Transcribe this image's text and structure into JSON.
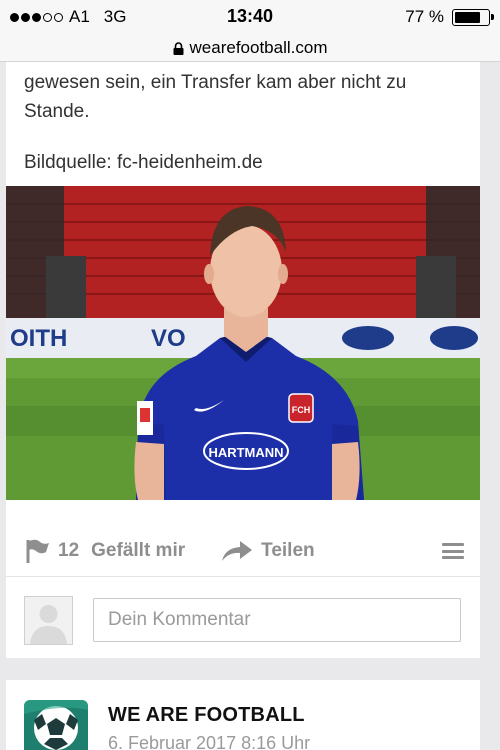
{
  "status_bar": {
    "carrier": "A1",
    "network": "3G",
    "time": "13:40",
    "battery_text": "77 %",
    "battery_level": 0.77,
    "signal_bars_filled": 3,
    "signal_bars_total": 5
  },
  "browser": {
    "url": "wearefootball.com",
    "lock_icon": "lock-icon"
  },
  "article": {
    "text": "gewesen sein, ein Transfer kam aber nicht zu Stande.",
    "image_source": "Bildquelle: fc-heidenheim.de",
    "photo": {
      "ad_board_left": "OITH",
      "ad_board_mid": "VO",
      "sponsor": "HARTMANN",
      "crest": "FCH"
    }
  },
  "actions": {
    "like_count": "12",
    "like_label": "Gefällt mir",
    "share_label": "Teilen",
    "like_icon": "flag-icon",
    "share_icon": "share-arrow-icon",
    "menu_icon": "menu-icon"
  },
  "comment": {
    "placeholder": "Dein Kommentar",
    "value": ""
  },
  "next_post": {
    "author": "WE ARE FOOTBALL",
    "date": "6. Februar 2017 8:16 Uhr"
  },
  "colors": {
    "page_bg": "#e9e9ec",
    "card_bg": "#ffffff",
    "action_grey": "#8e8e8e",
    "jersey_blue": "#1c2fa8",
    "stadium_red": "#b02020",
    "pitch_green": "#5f9a35"
  }
}
